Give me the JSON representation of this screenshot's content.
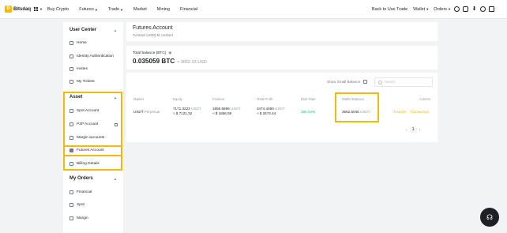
{
  "topbar": {
    "brand": "Bitsdaq",
    "nav_left": [
      "Buy Crypto",
      "Futures",
      "Trade",
      "Market",
      "Mining",
      "Financial"
    ],
    "back_link": "Back to Use Trade",
    "wallet": "Wallet",
    "orders": "Orders"
  },
  "sidebar": {
    "user_center": "User Center",
    "user_items": [
      "Home",
      "Identity Authentication",
      "Invites",
      "My Tickets"
    ],
    "asset": "Asset",
    "asset_items": [
      "Spot Account",
      "P2P Account",
      "Margin accounts",
      "Futures Account",
      "Billing Details"
    ],
    "my_orders": "My Orders",
    "order_items": [
      "Financial",
      "Spot",
      "Margin"
    ]
  },
  "header": {
    "title": "Futures Account",
    "subtitle": "Contract (USD)-M contract"
  },
  "balance": {
    "label": "Total balance (BTC)",
    "btc": "0.035059 BTC",
    "usd": "≈ 3662.33 USD"
  },
  "table": {
    "hide_small_label": "Show Small Balance",
    "search_placeholder": "Search",
    "columns": [
      "Market",
      "Equity",
      "Position",
      "Total Profit",
      "Risk Rate",
      "Wallet Balance",
      "Actions"
    ],
    "rows": [
      {
        "market": "USDT",
        "market_type": "Perpetual",
        "equity": "7171.3223",
        "equity_unit": "USDT",
        "equity_usd": "≈ $ 7121.32",
        "position": "1856.5899",
        "position_unit": "USDT",
        "position_usd": "≈ $ 1856.59",
        "profit": "3474.4360",
        "profit_unit": "USDT",
        "profit_usd": "≈ $ 3474.44",
        "risk_rate": "386.54%",
        "wallet_balance": "3662.5046",
        "wallet_unit": "USDT",
        "action_transfer": "Transfer",
        "action_transaction": "Transaction"
      }
    ],
    "page": "1"
  }
}
